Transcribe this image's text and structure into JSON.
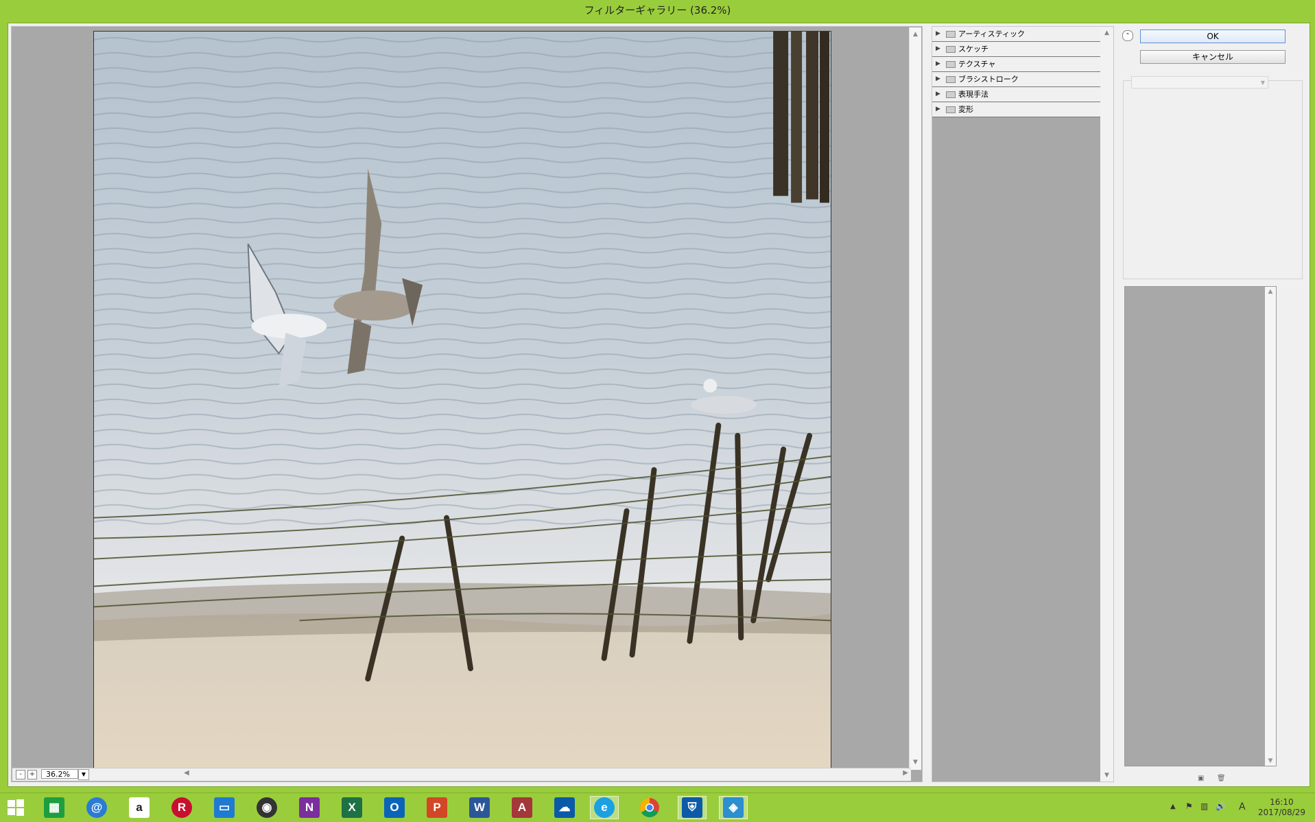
{
  "window": {
    "title": "フィルターギャラリー (36.2%)"
  },
  "preview": {
    "zoom_value": "36.2%",
    "zoom_out_label": "-",
    "zoom_in_label": "+"
  },
  "filter_tree": {
    "items": [
      {
        "label": "アーティスティック"
      },
      {
        "label": "スケッチ"
      },
      {
        "label": "テクスチャ"
      },
      {
        "label": "ブラシストローク"
      },
      {
        "label": "表現手法"
      },
      {
        "label": "変形"
      }
    ]
  },
  "buttons": {
    "ok": "OK",
    "cancel": "キャンセル"
  },
  "taskbar": {
    "apps": [
      {
        "name": "windows-start",
        "glyph": "",
        "color": "#9acd3c"
      },
      {
        "name": "store",
        "glyph": "",
        "color": "#1e9e3f"
      },
      {
        "name": "mail",
        "glyph": "@",
        "color": "#2a7bd4"
      },
      {
        "name": "amazon",
        "glyph": "a",
        "color": "#222222"
      },
      {
        "name": "rakuten",
        "glyph": "R",
        "color": "#c8102e"
      },
      {
        "name": "photos",
        "glyph": "",
        "color": "#1f7ad1"
      },
      {
        "name": "media",
        "glyph": "",
        "color": "#333333"
      },
      {
        "name": "onenote",
        "glyph": "N",
        "color": "#7b2e9e"
      },
      {
        "name": "excel",
        "glyph": "X",
        "color": "#1e7145"
      },
      {
        "name": "outlook",
        "glyph": "O",
        "color": "#0b64b8"
      },
      {
        "name": "powerpoint",
        "glyph": "P",
        "color": "#d24726"
      },
      {
        "name": "word",
        "glyph": "W",
        "color": "#2b579a"
      },
      {
        "name": "access",
        "glyph": "A",
        "color": "#a4373a"
      },
      {
        "name": "onedrive",
        "glyph": "",
        "color": "#0a5aa8"
      },
      {
        "name": "internet-explorer",
        "glyph": "e",
        "color": "#1ba1e2"
      },
      {
        "name": "chrome",
        "glyph": "",
        "color": "#ffffff"
      },
      {
        "name": "defender",
        "glyph": "",
        "color": "#0d5ba8"
      },
      {
        "name": "photoshop-elements",
        "glyph": "",
        "color": "#2c8fcf"
      }
    ],
    "tray": {
      "ime": "A",
      "time": "16:10",
      "date": "2017/08/29"
    }
  }
}
